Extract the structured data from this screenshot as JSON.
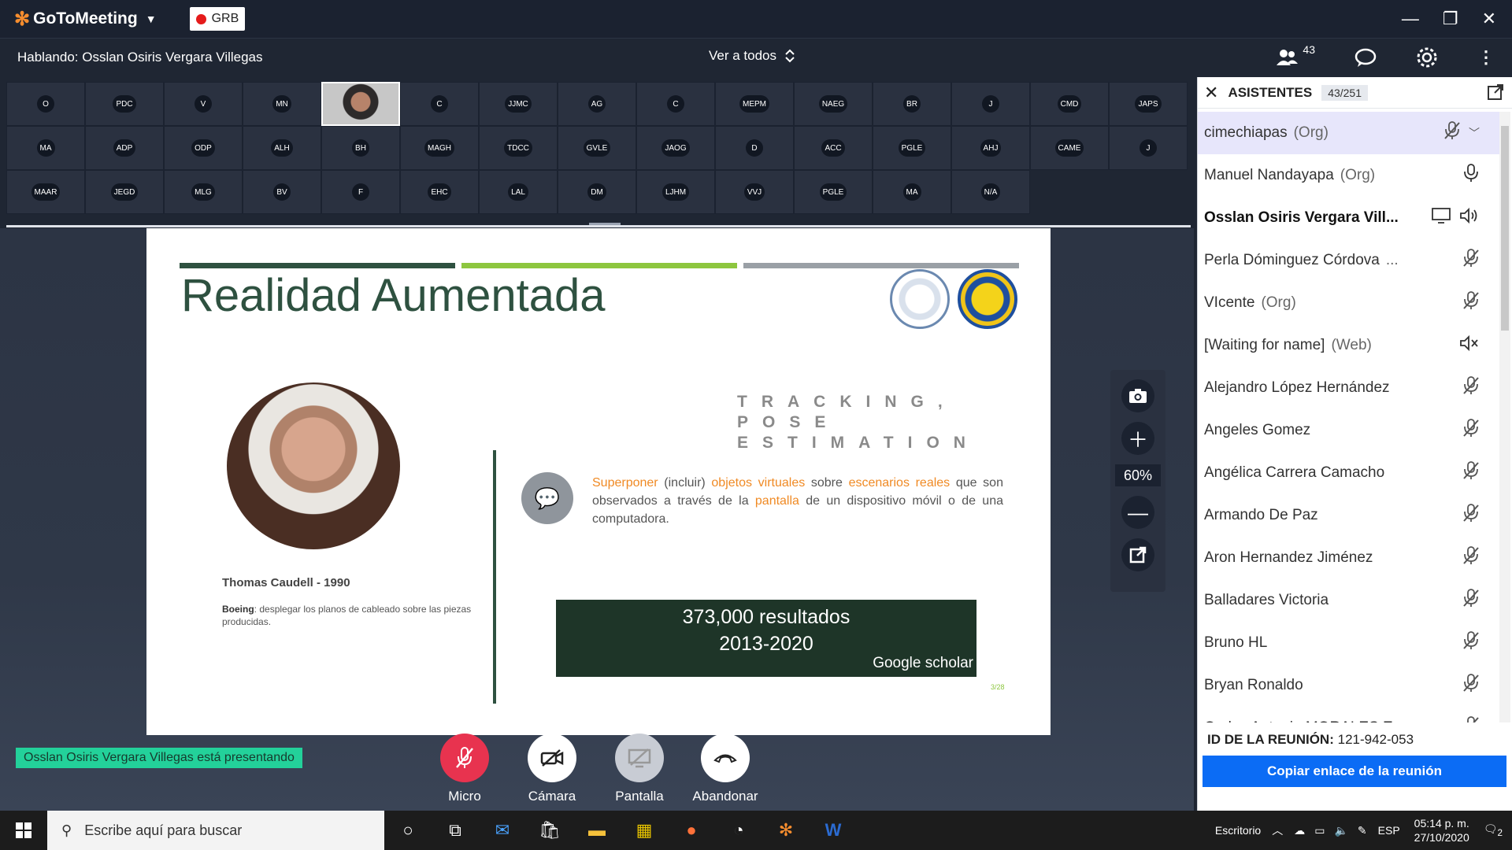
{
  "app": {
    "name": "GoToMeeting",
    "org_badge": "GRB",
    "speaking_label": "Hablando: Osslan Osiris Vergara Villegas",
    "view_mode": "Ver a todos",
    "attendee_count_badge": "43"
  },
  "tiles": [
    {
      "label": "O"
    },
    {
      "label": "PDC"
    },
    {
      "label": "V"
    },
    {
      "label": "MN"
    },
    {
      "label": "",
      "video": true
    },
    {
      "label": "C"
    },
    {
      "label": "JJMC"
    },
    {
      "label": "AG"
    },
    {
      "label": "C"
    },
    {
      "label": "MEPM"
    },
    {
      "label": "NAEG"
    },
    {
      "label": "BR"
    },
    {
      "label": "J"
    },
    {
      "label": "CMD"
    },
    {
      "label": "JAPS"
    },
    {
      "label": "MA"
    },
    {
      "label": "ADP"
    },
    {
      "label": "ODP"
    },
    {
      "label": "ALH"
    },
    {
      "label": "BH"
    },
    {
      "label": "MAGH"
    },
    {
      "label": "TDCC"
    },
    {
      "label": "GVLE"
    },
    {
      "label": "JAOG"
    },
    {
      "label": "D"
    },
    {
      "label": "ACC"
    },
    {
      "label": "PGLE"
    },
    {
      "label": "AHJ"
    },
    {
      "label": "CAME"
    },
    {
      "label": "J"
    },
    {
      "label": "MAAR"
    },
    {
      "label": "JEGD"
    },
    {
      "label": "MLG"
    },
    {
      "label": "BV"
    },
    {
      "label": "F"
    },
    {
      "label": "EHC"
    },
    {
      "label": "LAL"
    },
    {
      "label": "DM"
    },
    {
      "label": "LJHM"
    },
    {
      "label": "VVJ"
    },
    {
      "label": "PGLE"
    },
    {
      "label": "MA"
    },
    {
      "label": "N/A"
    }
  ],
  "slide": {
    "title": "Realidad Aumentada",
    "bar_colors": [
      "#2e5140",
      "#8dc63f",
      "#9aa0a6"
    ],
    "tracking_line1": "TRACKING, POSE",
    "tracking_line2": "ESTIMATION",
    "desc_parts": {
      "w1": "Superponer",
      "w2": "(incluir)",
      "w3": "objetos virtuales",
      "w4": "sobre",
      "w5": "escenarios reales",
      "w6": "que son observados a través de la",
      "w7": "pantalla",
      "w8": "de un dispositivo móvil o de una computadora."
    },
    "results_line1": "373,000 resultados",
    "results_line2": "2013-2020",
    "results_source": "Google scholar",
    "portrait_name": "Thomas Caudell - 1990",
    "portrait_desc_bold": "Boeing",
    "portrait_desc": ": desplegar los planos de cableado sobre las piezas producidas.",
    "page_number": "3/28"
  },
  "zoom": {
    "value": "60%"
  },
  "presenting_banner": "Osslan Osiris Vergara Villegas está presentando",
  "controls": {
    "mic": "Micro",
    "camera": "Cámara",
    "screen": "Pantalla",
    "leave": "Abandonar"
  },
  "panel": {
    "title": "ASISTENTES",
    "count": "43/251",
    "attendees": [
      {
        "name": "cimechiapas",
        "role": "(Org)",
        "icon": "mic-off-icon",
        "selected": true
      },
      {
        "name": "Manuel Nandayapa",
        "role": "(Org)",
        "icon": "mic-icon"
      },
      {
        "name": "Osslan Osiris Vergara Vill...",
        "role": "",
        "icon": "speaker-active-icon",
        "bold": true
      },
      {
        "name": "Perla Dóminguez Córdova",
        "role": "...",
        "icon": "mic-off-icon"
      },
      {
        "name": "VIcente",
        "role": "(Org)",
        "icon": "mic-off-icon"
      },
      {
        "name": "[Waiting for name]",
        "role": "(Web)",
        "icon": "speaker-muted-icon"
      },
      {
        "name": "Alejandro López Hernández",
        "role": "",
        "icon": "mic-off-icon"
      },
      {
        "name": "Angeles Gomez",
        "role": "",
        "icon": "mic-off-icon"
      },
      {
        "name": "Angélica Carrera Camacho",
        "role": "",
        "icon": "mic-off-icon"
      },
      {
        "name": "Armando De Paz",
        "role": "",
        "icon": "mic-off-icon"
      },
      {
        "name": "Aron Hernandez Jiménez",
        "role": "",
        "icon": "mic-off-icon"
      },
      {
        "name": "Balladares Victoria",
        "role": "",
        "icon": "mic-off-icon"
      },
      {
        "name": "Bruno HL",
        "role": "",
        "icon": "mic-off-icon"
      },
      {
        "name": "Bryan Ronaldo",
        "role": "",
        "icon": "mic-off-icon"
      },
      {
        "name": "Carlos Antonio MORALES E",
        "role": "",
        "icon": "mic-off-icon"
      }
    ],
    "meeting_id_label": "ID DE LA REUNIÓN:",
    "meeting_id": "121-942-053",
    "copy_link": "Copiar enlace de la reunión"
  },
  "taskbar": {
    "search_placeholder": "Escribe aquí para buscar",
    "desktop_label": "Escritorio",
    "lang": "ESP",
    "time": "05:14 p. m.",
    "date": "27/10/2020",
    "notif_count": "2"
  }
}
